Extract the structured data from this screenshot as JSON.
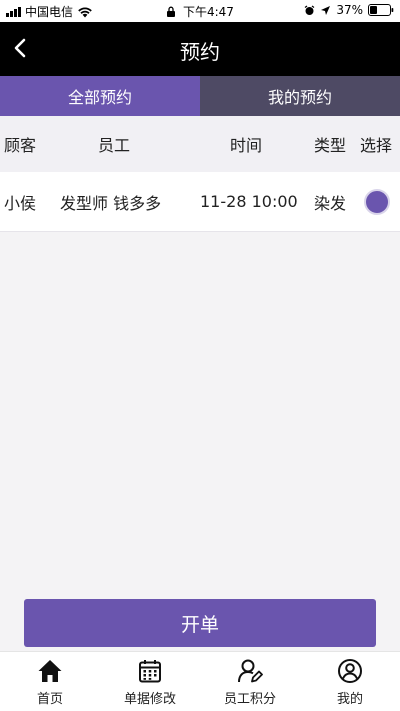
{
  "status_bar": {
    "carrier": "中国电信",
    "time": "下午4:47",
    "battery": "37%"
  },
  "header": {
    "title": "预约"
  },
  "tabs": [
    {
      "label": "全部预约",
      "active": true
    },
    {
      "label": "我的预约",
      "active": false
    }
  ],
  "table": {
    "columns": {
      "customer": "顾客",
      "staff": "员工",
      "time": "时间",
      "type": "类型",
      "select": "选择"
    },
    "rows": [
      {
        "customer": "小侯",
        "staff": "发型师 钱多多",
        "time": "11-28 10:00",
        "type": "染发",
        "selected": true
      }
    ]
  },
  "open_order_button": "开单",
  "bottom_nav": [
    {
      "label": "首页",
      "icon": "home-icon"
    },
    {
      "label": "单据修改",
      "icon": "calendar-icon"
    },
    {
      "label": "员工积分",
      "icon": "user-edit-icon"
    },
    {
      "label": "我的",
      "icon": "profile-icon"
    }
  ],
  "colors": {
    "accent": "#6a55ae",
    "tab_inactive": "#4e4a64",
    "header_bg": "#000000"
  }
}
